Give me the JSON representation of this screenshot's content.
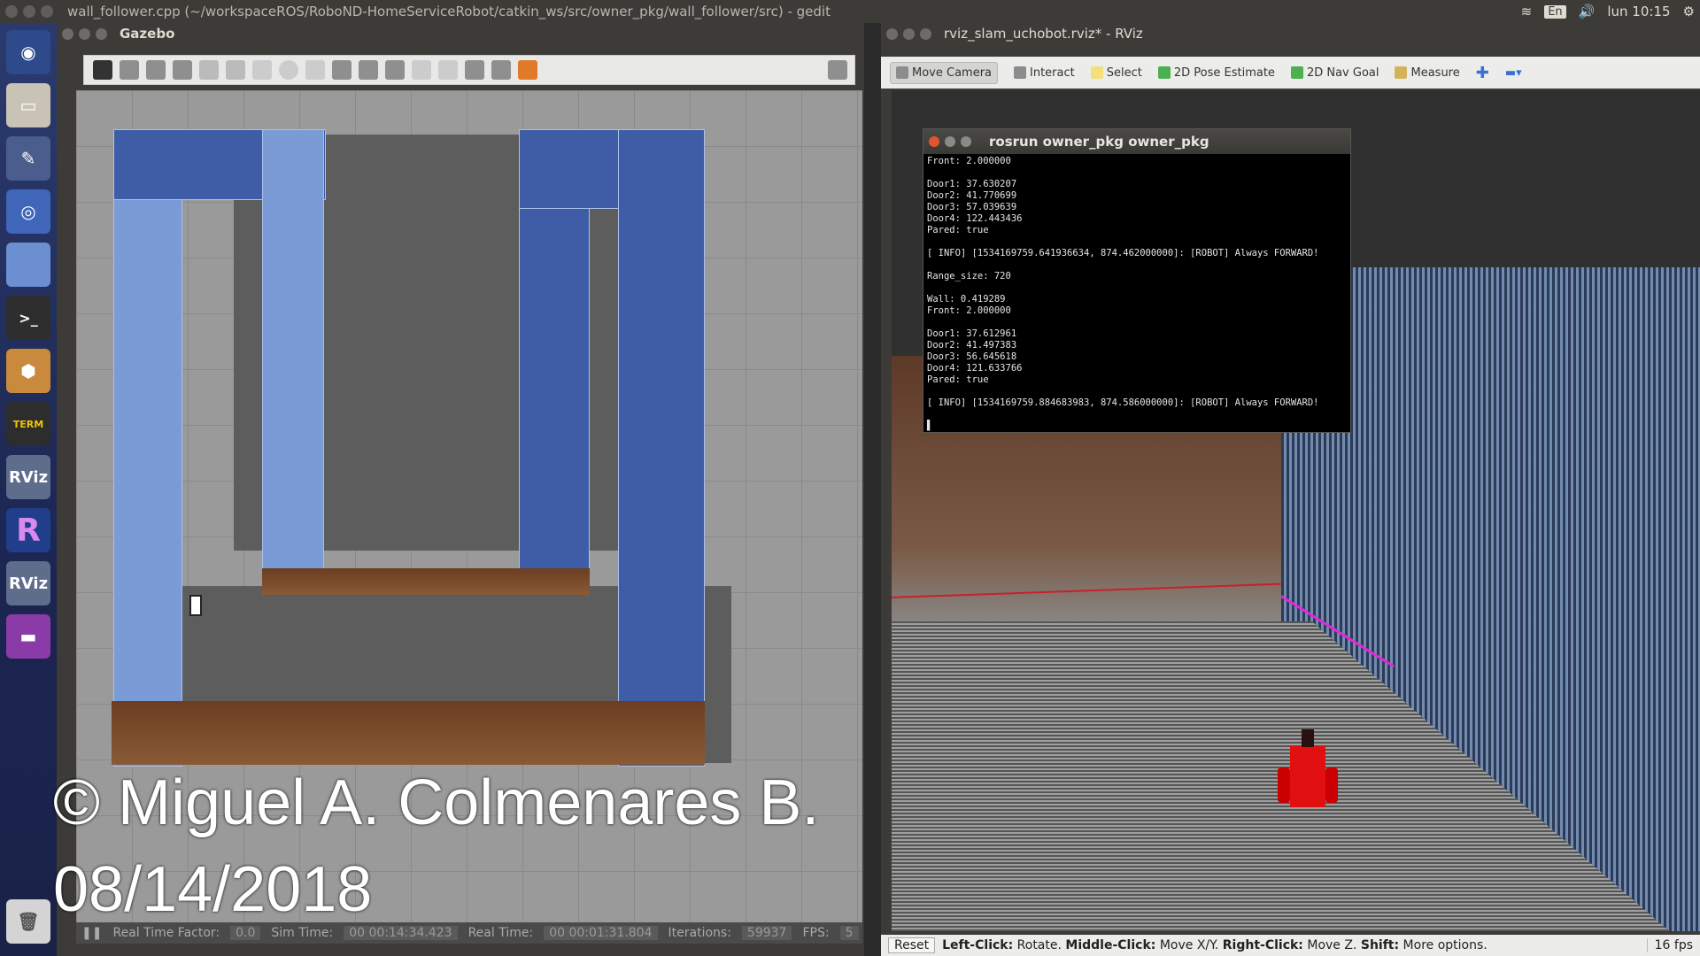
{
  "topbar": {
    "window_title": "wall_follower.cpp (~/workspaceROS/RoboND-HomeServiceRobot/catkin_ws/src/owner_pkg/wall_follower/src) - gedit",
    "lang": "En",
    "clock": "lun 10:15"
  },
  "launcher": {
    "items": [
      "ubuntu-home-icon",
      "files-icon",
      "settings-icon",
      "chromium-icon",
      "app-icon",
      "terminal-icon",
      "package-icon",
      "xterm-icon",
      "rviz-icon",
      "r-icon",
      "rviz-icon",
      "window-icon",
      "trash-icon"
    ],
    "labels": {
      "xterm": "TERM",
      "rviz": "RViz",
      "r": "R"
    }
  },
  "gazebo": {
    "title": "Gazebo",
    "status": {
      "real_time_factor_label": "Real Time Factor:",
      "real_time_factor_value": "0.0",
      "sim_time_label": "Sim Time:",
      "sim_time_value": "00 00:14:34.423",
      "real_time_label": "Real Time:",
      "real_time_value": "00 00:01:31.804",
      "iterations_label": "Iterations:",
      "iterations_value": "59937",
      "fps_label": "FPS:",
      "fps_value": "5"
    }
  },
  "rviz": {
    "title": "rviz_slam_uchobot.rviz* - RViz",
    "tools": {
      "move_camera": "Move Camera",
      "interact": "Interact",
      "select": "Select",
      "pose_estimate": "2D Pose Estimate",
      "nav_goal": "2D Nav Goal",
      "measure": "Measure"
    },
    "status": {
      "reset": "Reset",
      "left_click": "Left-Click:",
      "left_click_action": "Rotate.",
      "middle_click": "Middle-Click:",
      "middle_click_action": "Move X/Y.",
      "right_click": "Right-Click:",
      "right_click_action": "Move Z.",
      "shift": "Shift:",
      "shift_action": "More options.",
      "fps": "16 fps"
    }
  },
  "terminal": {
    "title": "rosrun owner_pkg owner_pkg",
    "lines": [
      "Front: 2.000000",
      "",
      "Door1: 37.630207",
      "Door2: 41.770699",
      "Door3: 57.039639",
      "Door4: 122.443436",
      "Pared: true",
      "",
      "[ INFO] [1534169759.641936634, 874.462000000]: [ROBOT] Always FORWARD!",
      "",
      "Range_size: 720",
      "",
      "Wall: 0.419289",
      "Front: 2.000000",
      "",
      "Door1: 37.612961",
      "Door2: 41.497383",
      "Door3: 56.645618",
      "Door4: 121.633766",
      "Pared: true",
      "",
      "[ INFO] [1534169759.884683983, 874.586000000]: [ROBOT] Always FORWARD!",
      "",
      "▌"
    ]
  },
  "watermark": {
    "line1": "© Miguel A. Colmenares B.",
    "line2": "08/14/2018"
  }
}
